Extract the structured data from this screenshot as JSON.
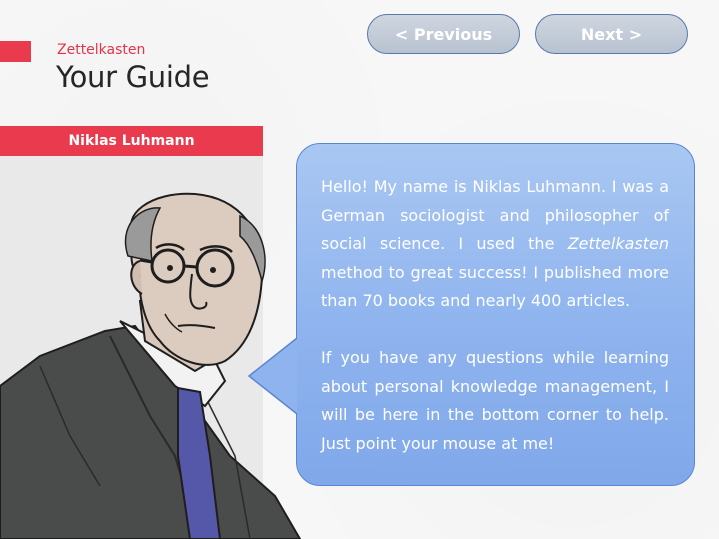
{
  "header": {
    "subtitle": "Zettelkasten",
    "title": "Your Guide"
  },
  "nav": {
    "previous_label": "< Previous",
    "next_label": "Next >"
  },
  "guide": {
    "name": "Niklas Luhmann"
  },
  "speech": {
    "p1_before": "Hello! My name is Niklas Luhmann. I was a German sociologist and philosopher of social science. I used the ",
    "p1_em": "Zettelkasten",
    "p1_after": " method to great success! I published more than 70 books and nearly 400 articles.",
    "p2": "If you have any questions while learning about personal knowledge management, I will be here in the bottom corner to help. Just point your mouse at me!"
  },
  "colors": {
    "accent": "#ea3b4e",
    "bubble": "#8eb3ee",
    "button": "#c4ccd8"
  }
}
